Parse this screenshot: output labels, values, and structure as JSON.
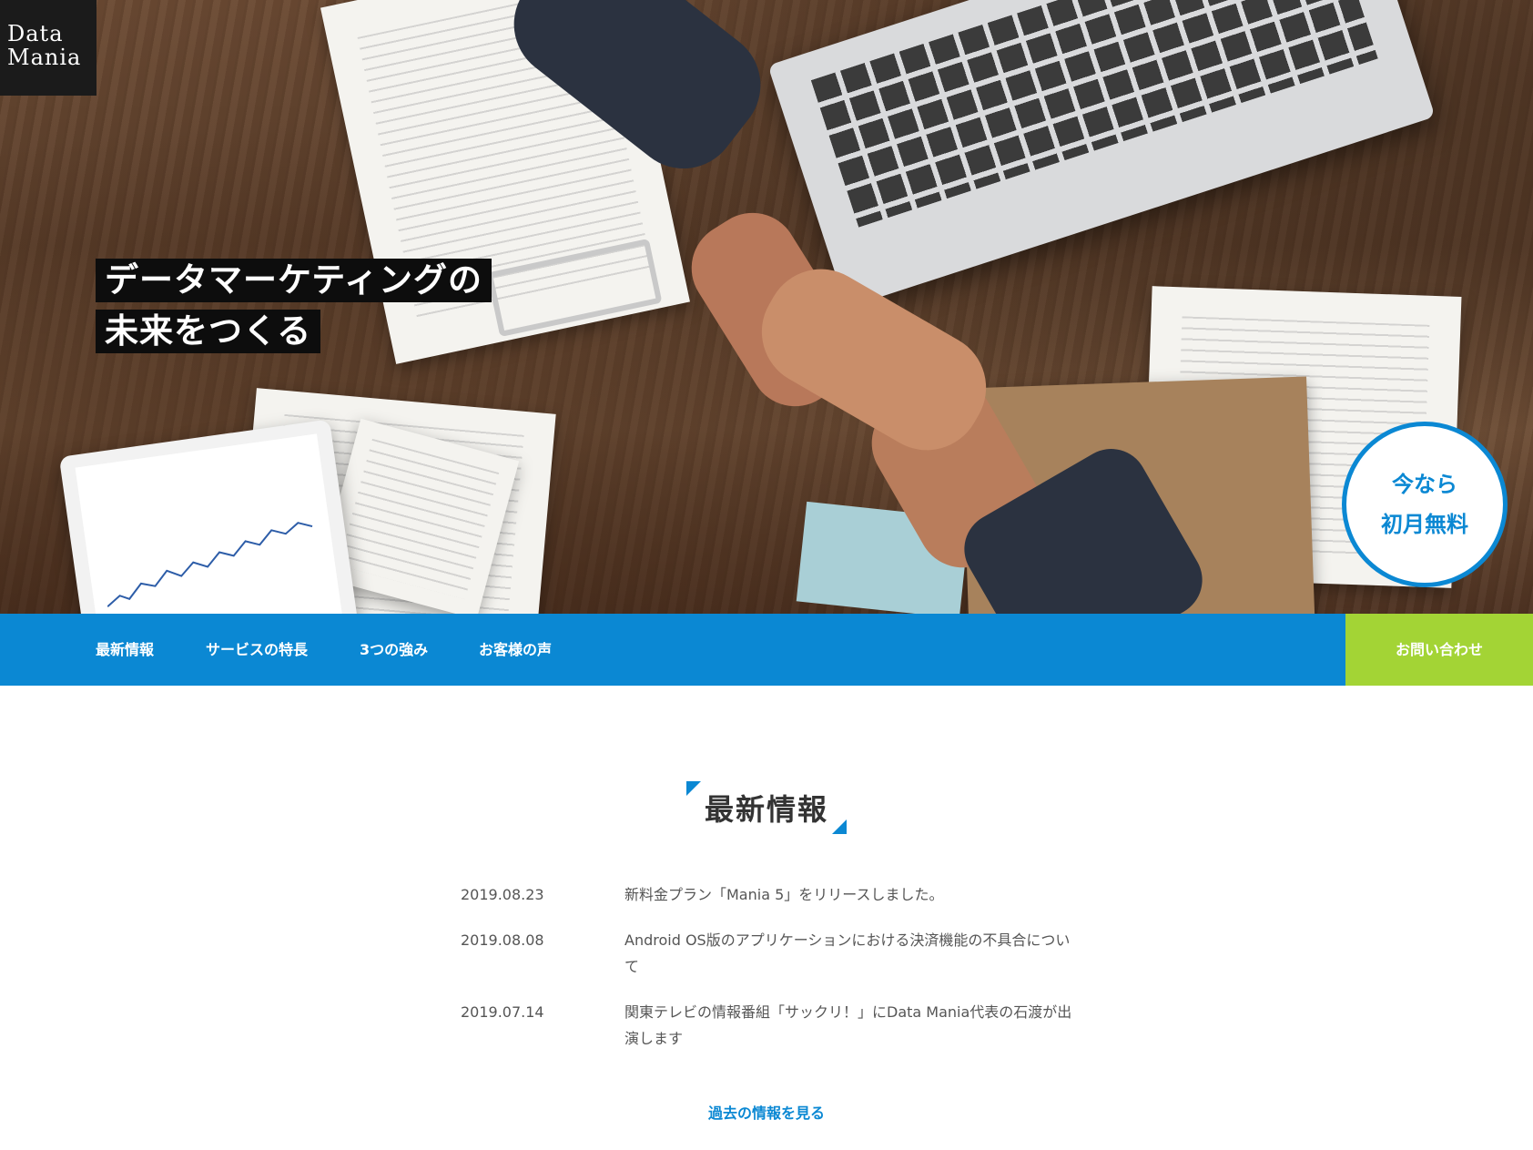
{
  "brand": {
    "logo_line1": "Data",
    "logo_line2": "Mania"
  },
  "hero": {
    "headline_line1": "データマーケティングの",
    "headline_line2": "未来をつくる",
    "badge_line1": "今なら",
    "badge_line2": "初月無料"
  },
  "nav": {
    "items": [
      {
        "label": "最新情報"
      },
      {
        "label": "サービスの特長"
      },
      {
        "label": "3つの強み"
      },
      {
        "label": "お客様の声"
      }
    ],
    "contact_label": "お問い合わせ"
  },
  "news": {
    "title": "最新情報",
    "items": [
      {
        "date": "2019.08.23",
        "text": "新料金プラン「Mania 5」をリリースしました。"
      },
      {
        "date": "2019.08.08",
        "text": "Android OS版のアプリケーションにおける決済機能の不具合について"
      },
      {
        "date": "2019.07.14",
        "text": "関東テレビの情報番組「サックリ！」にData Mania代表の石渡が出演します"
      }
    ],
    "more_label": "過去の情報を見る"
  },
  "colors": {
    "primary": "#0b88d3",
    "accent": "#a3d435",
    "dark": "#1b1b1b"
  }
}
